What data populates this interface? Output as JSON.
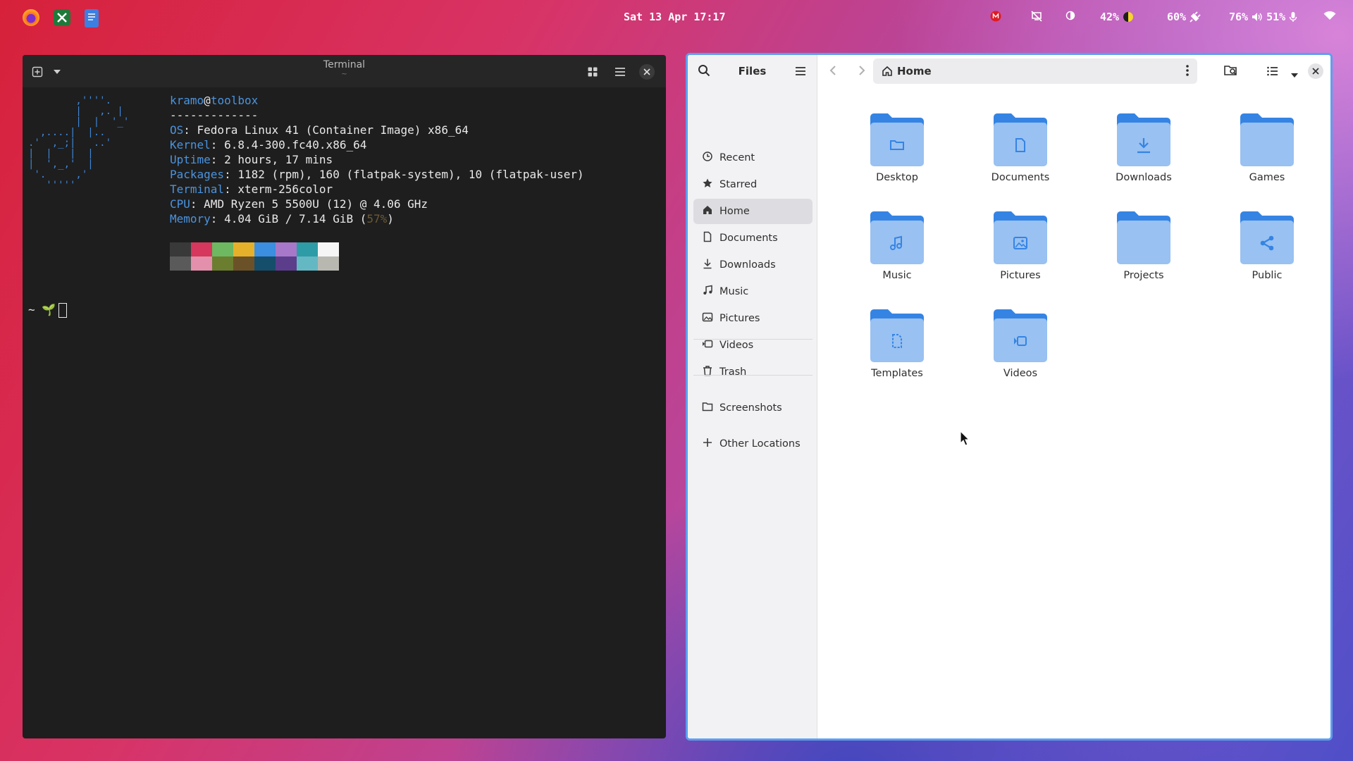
{
  "topbar": {
    "clock": "Sat 13 Apr 17:17",
    "tray": {
      "brightness": "42%",
      "volume": "60%",
      "battery": "76%",
      "speaker": "51%"
    }
  },
  "terminal": {
    "title": "Terminal",
    "subtitle": "~",
    "user": "kramo",
    "at": "@",
    "host": "toolbox",
    "separator": "-------------",
    "info": [
      {
        "key": "OS",
        "value": ": Fedora Linux 41 (Container Image) x86_64"
      },
      {
        "key": "Kernel",
        "value": ": 6.8.4-300.fc40.x86_64"
      },
      {
        "key": "Uptime",
        "value": ": 2 hours, 17 mins"
      },
      {
        "key": "Packages",
        "value": ": 1182 (rpm), 160 (flatpak-system), 10 (flatpak-user)"
      },
      {
        "key": "Terminal",
        "value": ": xterm-256color"
      },
      {
        "key": "CPU",
        "value": ": AMD Ryzen 5 5500U (12) @ 4.06 GHz"
      },
      {
        "key": "Memory",
        "value": ": 4.04 GiB / 7.14 GiB ("
      }
    ],
    "memory_percent": "57%",
    "memory_close": ")",
    "palette_top": [
      "#393939",
      "#d6375d",
      "#6db861",
      "#e6b12a",
      "#3b8ee0",
      "#a778c9",
      "#2d9ca6",
      "#f5f5f5"
    ],
    "palette_bottom": [
      "#5a5a5a",
      "#e290ab",
      "#6b7d2e",
      "#6b5128",
      "#154e6a",
      "#5b3d8c",
      "#64b8c4",
      "#b8b8b0"
    ],
    "prompt_dir": "~",
    "prompt_symbol": "🌱",
    "ascii_art": "        ,''''.\n        |   ,. |\n        |  |  '_'\n  ,....|  |..\n.'  ,_;|   ..'\n|  |   |  |\n|  ',_,'  |\n '.     ,'\n   '''''"
  },
  "files": {
    "title": "Files",
    "path": "Home",
    "sidebar": [
      {
        "label": "Recent",
        "icon": "clock-icon"
      },
      {
        "label": "Starred",
        "icon": "star-icon"
      },
      {
        "label": "Home",
        "icon": "home-icon",
        "selected": true
      },
      {
        "label": "Documents",
        "icon": "document-icon"
      },
      {
        "label": "Downloads",
        "icon": "download-icon"
      },
      {
        "label": "Music",
        "icon": "music-icon"
      },
      {
        "label": "Pictures",
        "icon": "picture-icon"
      },
      {
        "label": "Videos",
        "icon": "video-icon"
      },
      {
        "label": "Trash",
        "icon": "trash-icon"
      },
      {
        "label": "Screenshots",
        "icon": "folder-icon"
      },
      {
        "label": "Other Locations",
        "icon": "plus-icon"
      }
    ],
    "folders": [
      {
        "label": "Desktop",
        "emblem": "folder"
      },
      {
        "label": "Documents",
        "emblem": "document"
      },
      {
        "label": "Downloads",
        "emblem": "download"
      },
      {
        "label": "Games",
        "emblem": "none"
      },
      {
        "label": "Music",
        "emblem": "music"
      },
      {
        "label": "Pictures",
        "emblem": "picture"
      },
      {
        "label": "Projects",
        "emblem": "none"
      },
      {
        "label": "Public",
        "emblem": "share"
      },
      {
        "label": "Templates",
        "emblem": "template"
      },
      {
        "label": "Videos",
        "emblem": "video"
      }
    ]
  },
  "colors": {
    "accent": "#5ba0ee",
    "folder_back": "#3584e4",
    "folder_front": "#99c1f1"
  }
}
